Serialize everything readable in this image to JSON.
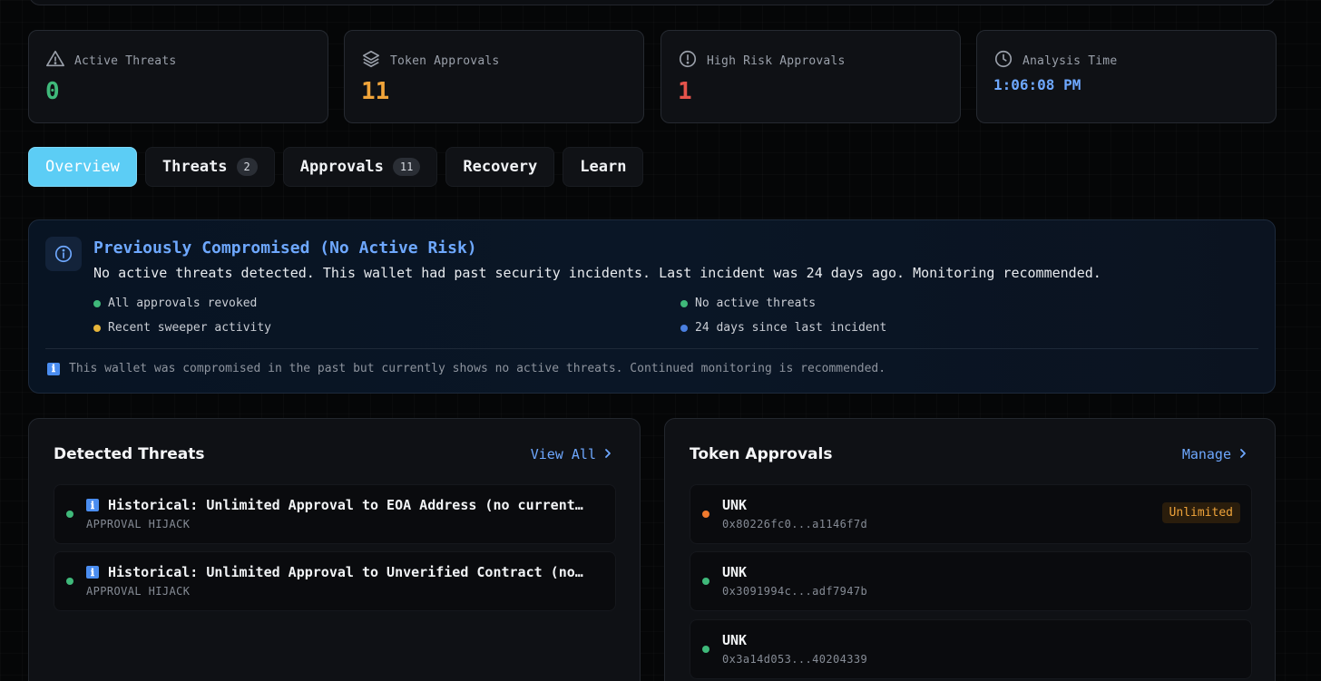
{
  "stats": [
    {
      "label": "Active Threats",
      "value": "0",
      "icon": "warning-triangle-icon",
      "color": "#3fb97a"
    },
    {
      "label": "Token Approvals",
      "value": "11",
      "icon": "layers-icon",
      "color": "#f0a43a"
    },
    {
      "label": "High Risk Approvals",
      "value": "1",
      "icon": "alert-circle-icon",
      "color": "#e5534b"
    },
    {
      "label": "Analysis Time",
      "value": "1:06:08 PM",
      "icon": "clock-icon",
      "color": "#6ea8ff"
    }
  ],
  "tabs": [
    {
      "label": "Overview",
      "active": true
    },
    {
      "label": "Threats",
      "count": "2"
    },
    {
      "label": "Approvals",
      "count": "11"
    },
    {
      "label": "Recovery"
    },
    {
      "label": "Learn"
    }
  ],
  "banner": {
    "icon": "info-icon",
    "title": "Previously Compromised (No Active Risk)",
    "description": "No active threats detected. This wallet had past security incidents. Last incident was 24 days ago. Monitoring recommended.",
    "bullets": [
      {
        "text": "All approvals revoked",
        "color": "#3fb97a"
      },
      {
        "text": "No active threats",
        "color": "#3fb97a"
      },
      {
        "text": "Recent sweeper activity",
        "color": "#e6b53a"
      },
      {
        "text": "24 days since last incident",
        "color": "#4a7fe0"
      }
    ],
    "footnote_icon": "ℹ",
    "footnote": "This wallet was compromised in the past but currently shows no active threats. Continued monitoring is recommended."
  },
  "threats_panel": {
    "title": "Detected Threats",
    "link": "View All",
    "items": [
      {
        "icon": "ℹ",
        "title": "Historical: Unlimited Approval to EOA Address (no current…",
        "type": "APPROVAL HIJACK",
        "color": "#3fb97a"
      },
      {
        "icon": "ℹ",
        "title": "Historical: Unlimited Approval to Unverified Contract (no…",
        "type": "APPROVAL HIJACK",
        "color": "#3fb97a"
      }
    ]
  },
  "approvals_panel": {
    "title": "Token Approvals",
    "link": "Manage",
    "items": [
      {
        "token": "UNK",
        "address": "0x80226fc0...a1146f7d",
        "badge": "Unlimited",
        "color": "#f07a2e"
      },
      {
        "token": "UNK",
        "address": "0x3091994c...adf7947b",
        "color": "#3fb97a"
      },
      {
        "token": "UNK",
        "address": "0x3a14d053...40204339",
        "color": "#3fb97a"
      }
    ]
  }
}
